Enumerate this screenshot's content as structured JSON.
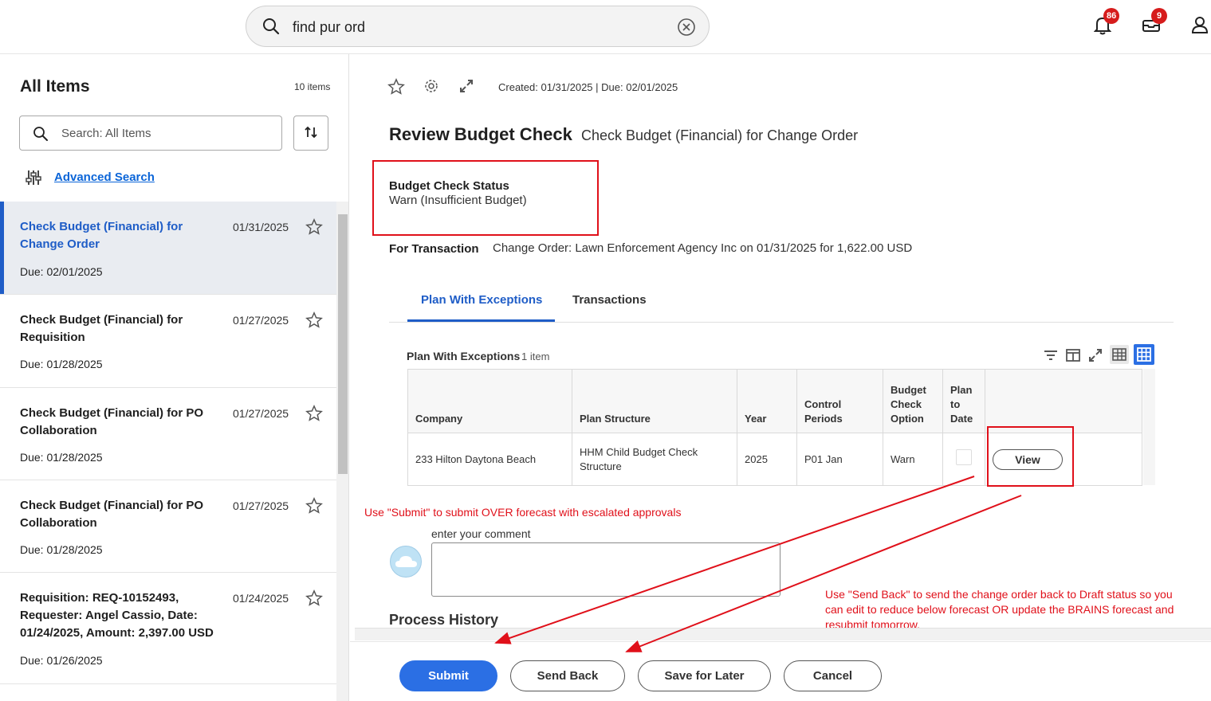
{
  "search": {
    "value": "find pur ord"
  },
  "header": {
    "notifications_count": "86",
    "inbox_count": "9"
  },
  "sidebar": {
    "title": "All Items",
    "count": "10 items",
    "search_placeholder": "Search: All Items",
    "advanced_search": "Advanced Search",
    "items": [
      {
        "title": "Check Budget (Financial) for Change Order",
        "date": "01/31/2025",
        "due": "Due: 02/01/2025"
      },
      {
        "title": "Check Budget (Financial) for Requisition",
        "date": "01/27/2025",
        "due": "Due: 01/28/2025"
      },
      {
        "title": "Check Budget (Financial) for PO Collaboration",
        "date": "01/27/2025",
        "due": "Due: 01/28/2025"
      },
      {
        "title": "Check Budget (Financial) for PO Collaboration",
        "date": "01/27/2025",
        "due": "Due: 01/28/2025"
      },
      {
        "title": "Requisition: REQ-10152493, Requester: Angel Cassio, Date: 01/24/2025, Amount: 2,397.00 USD",
        "date": "01/24/2025",
        "due": "Due: 01/26/2025"
      }
    ]
  },
  "main": {
    "created": "Created: 01/31/2025 | Due: 02/01/2025",
    "title": "Review Budget Check",
    "subtitle": "Check Budget (Financial) for Change Order",
    "budget_check_status_label": "Budget Check Status",
    "budget_check_status_value": "Warn (Insufficient Budget)",
    "for_transaction_label": "For Transaction",
    "for_transaction_value": "Change Order: Lawn Enforcement Agency Inc on 01/31/2025 for 1,622.00 USD",
    "tabs": [
      "Plan With Exceptions",
      "Transactions"
    ],
    "grid": {
      "title": "Plan With Exceptions",
      "count": "1 item",
      "headers": [
        "Company",
        "Plan Structure",
        "Year",
        "Control Periods",
        "Budget Check Option",
        "Plan to Date",
        ""
      ],
      "row": [
        "233 Hilton Daytona Beach",
        "HHM Child Budget Check Structure",
        "2025",
        "P01 Jan",
        "Warn",
        "",
        "View"
      ]
    },
    "comment_label": "enter your comment",
    "process_history": "Process History",
    "annotation_submit": "Use \"Submit\" to submit OVER forecast with escalated approvals",
    "annotation_sendback": "Use \"Send Back\" to send the change order back to Draft status so you can edit to reduce below forecast OR update the BRAINS forecast and resubmit tomorrow.",
    "buttons": {
      "submit": "Submit",
      "send_back": "Send Back",
      "save_later": "Save for Later",
      "cancel": "Cancel"
    }
  },
  "colors": {
    "accent": "#1f5dc7",
    "primary_button": "#2b6fe4",
    "annotation": "#e0101a",
    "badge": "#d61c1c"
  }
}
